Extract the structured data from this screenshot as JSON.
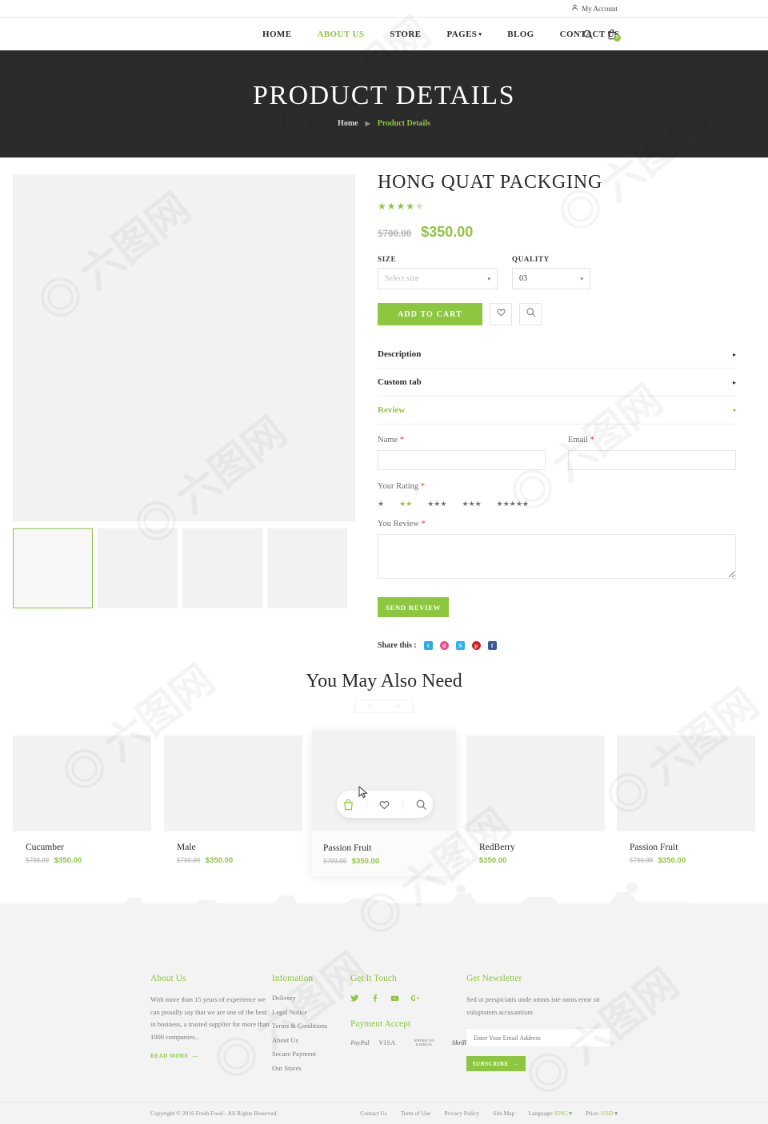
{
  "topbar": {
    "account_label": "My Account",
    "account_icon": "user-icon"
  },
  "nav": {
    "items": [
      {
        "label": "HOME",
        "active": false,
        "caret": false
      },
      {
        "label": "ABOUT US",
        "active": true,
        "caret": false
      },
      {
        "label": "STORE",
        "active": false,
        "caret": false
      },
      {
        "label": "PAGES",
        "active": false,
        "caret": true
      },
      {
        "label": "BLOG",
        "active": false,
        "caret": false
      },
      {
        "label": "CONTACT US",
        "active": false,
        "caret": false
      }
    ],
    "search_icon": "search-icon",
    "cart_icon": "shopping-bag-icon",
    "cart_count": "5"
  },
  "hero": {
    "title": "PRODUCT DETAILS",
    "breadcrumb_home": "Home",
    "breadcrumb_sep": "▶",
    "breadcrumb_current": "Product Details"
  },
  "product": {
    "title": "HONG QUAT PACKGING",
    "rating": 4.5,
    "stars_full": 4,
    "stars_half": 1,
    "old_price": "$700.00",
    "new_price": "$350.00",
    "size_label": "SIZE",
    "size_value": "Select size",
    "quality_label": "QUALITY",
    "quality_value": "03",
    "add_to_cart": "ADD TO CART",
    "wishlist_icon": "heart-icon",
    "compare_icon": "search-icon",
    "thumbs": [
      {
        "active": true
      },
      {
        "active": false
      },
      {
        "active": false
      },
      {
        "active": false
      }
    ]
  },
  "accordion": [
    {
      "label": "Description",
      "open": false,
      "marker": "▸"
    },
    {
      "label": "Custom tab",
      "open": false,
      "marker": "▸"
    },
    {
      "label": "Review",
      "open": true,
      "marker": "▾"
    }
  ],
  "review_form": {
    "name_label": "Name",
    "name_value": "",
    "email_label": "Email",
    "email_value": "",
    "rating_label": "Your Rating",
    "rating_groups": [
      {
        "stars": 1,
        "active": false
      },
      {
        "stars": 2,
        "active": true
      },
      {
        "stars": 3,
        "active": false
      },
      {
        "stars": 3,
        "active": false
      },
      {
        "stars": 5,
        "active": false
      }
    ],
    "review_label": "You Review",
    "review_value": "",
    "required_mark": "*",
    "submit_label": "SEND REVIEW"
  },
  "share": {
    "label": "Share this :",
    "items": [
      {
        "name": "twitter-icon",
        "glyph": "t",
        "color": "#2eacdf"
      },
      {
        "name": "dribbble-icon",
        "glyph": "d",
        "color": "#ea4c89"
      },
      {
        "name": "skype-icon",
        "glyph": "S",
        "color": "#30b3ea"
      },
      {
        "name": "pinterest-icon",
        "glyph": "p",
        "color": "#cb2027"
      },
      {
        "name": "facebook-icon",
        "glyph": "f",
        "color": "#3b5998"
      }
    ]
  },
  "related": {
    "heading": "You May Also Need",
    "prev": "‹",
    "next": "›",
    "items": [
      {
        "name": "Cucumber",
        "old_price": "$700.00",
        "new_price": "$350.00",
        "featured": false
      },
      {
        "name": "Male",
        "old_price": "$700.00",
        "new_price": "$350.00",
        "featured": false
      },
      {
        "name": "Passion Fruit",
        "old_price": "$700.00",
        "new_price": "$350.00",
        "featured": true
      },
      {
        "name": "RedBerry",
        "old_price": "",
        "new_price": "$350.00",
        "featured": false
      },
      {
        "name": "Passion Fruit",
        "old_price": "$700.00",
        "new_price": "$350.00",
        "featured": false
      }
    ],
    "hover_icons": [
      "shopping-bag-icon",
      "heart-icon",
      "search-icon"
    ]
  },
  "footer": {
    "about": {
      "title": "About Us",
      "text": "With more than 15 years of experience we can proudly say that we are one of the best in business, a trusted supplier for more than 1000 companies..",
      "readmore": "READ MORE"
    },
    "information": {
      "title": "Infomation",
      "links": [
        "Delivery",
        "Legal Notice",
        "Terms & Conditions",
        "About Us",
        "Secure Payment",
        "Our Stores"
      ]
    },
    "touch": {
      "title": "Get It Touch",
      "socials": [
        "twitter-icon",
        "facebook-icon",
        "youtube-icon",
        "google-plus-icon"
      ],
      "payment_title": "Payment Accept",
      "payments": [
        "PayPal",
        "VISA",
        "AMERICAN EXPRESS",
        "Skrill"
      ]
    },
    "newsletter": {
      "title": "Get Newsletter",
      "text": "Sed ut perspiciatis unde omnis iste natus error sit voluptatem accusantium",
      "placeholder": "Enter Your Email Address",
      "value": "",
      "button": "SUBSCRIBE",
      "button_arrow": "→"
    }
  },
  "copyright": {
    "text": "Copyright © 2016 Fresh Food - All Rights Reserved.",
    "links": [
      "Contact Us",
      "Term of Use",
      "Privacy Policy",
      "Site Map"
    ],
    "language_label": "Language:",
    "language_value": "ENG",
    "price_label": "Price:",
    "price_value": "USD",
    "caret": "▾"
  },
  "theme": {
    "accent": "#8dc63f",
    "dark": "#2b2b2b",
    "muted": "#f2f2f2"
  }
}
